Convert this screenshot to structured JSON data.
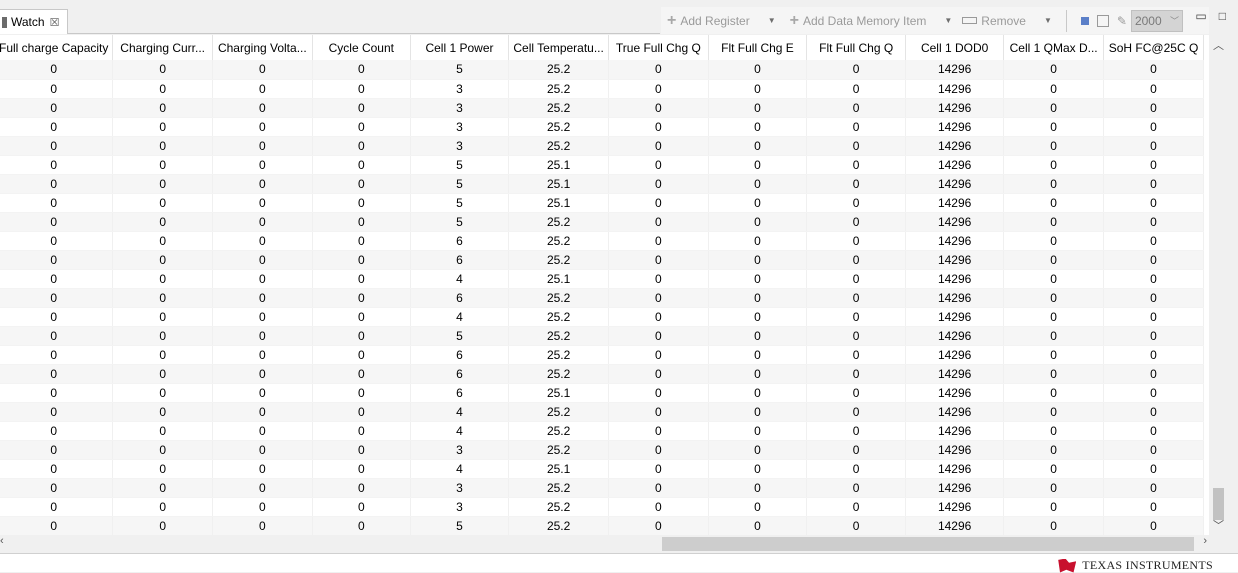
{
  "view": {
    "tab_title": "Watch",
    "close_glyph": "☒"
  },
  "toolbar": {
    "add_register": "Add Register",
    "add_data_memory_item": "Add Data Memory Item",
    "remove": "Remove",
    "interval": "2000"
  },
  "columns": [
    "Full charge Capacity",
    "Charging Curr...",
    "Charging Volta...",
    "Cycle Count",
    "Cell 1 Power",
    "Cell Temperatu...",
    "True Full Chg Q",
    "Flt Full Chg E",
    "Flt Full Chg Q",
    "Cell 1 DOD0",
    "Cell 1 QMax D...",
    "SoH FC@25C Q"
  ],
  "rows": [
    [
      "0",
      "0",
      "0",
      "0",
      "5",
      "25.2",
      "0",
      "0",
      "0",
      "14296",
      "0",
      "0"
    ],
    [
      "0",
      "0",
      "0",
      "0",
      "3",
      "25.2",
      "0",
      "0",
      "0",
      "14296",
      "0",
      "0"
    ],
    [
      "0",
      "0",
      "0",
      "0",
      "3",
      "25.2",
      "0",
      "0",
      "0",
      "14296",
      "0",
      "0"
    ],
    [
      "0",
      "0",
      "0",
      "0",
      "3",
      "25.2",
      "0",
      "0",
      "0",
      "14296",
      "0",
      "0"
    ],
    [
      "0",
      "0",
      "0",
      "0",
      "3",
      "25.2",
      "0",
      "0",
      "0",
      "14296",
      "0",
      "0"
    ],
    [
      "0",
      "0",
      "0",
      "0",
      "5",
      "25.1",
      "0",
      "0",
      "0",
      "14296",
      "0",
      "0"
    ],
    [
      "0",
      "0",
      "0",
      "0",
      "5",
      "25.1",
      "0",
      "0",
      "0",
      "14296",
      "0",
      "0"
    ],
    [
      "0",
      "0",
      "0",
      "0",
      "5",
      "25.1",
      "0",
      "0",
      "0",
      "14296",
      "0",
      "0"
    ],
    [
      "0",
      "0",
      "0",
      "0",
      "5",
      "25.2",
      "0",
      "0",
      "0",
      "14296",
      "0",
      "0"
    ],
    [
      "0",
      "0",
      "0",
      "0",
      "6",
      "25.2",
      "0",
      "0",
      "0",
      "14296",
      "0",
      "0"
    ],
    [
      "0",
      "0",
      "0",
      "0",
      "6",
      "25.2",
      "0",
      "0",
      "0",
      "14296",
      "0",
      "0"
    ],
    [
      "0",
      "0",
      "0",
      "0",
      "4",
      "25.1",
      "0",
      "0",
      "0",
      "14296",
      "0",
      "0"
    ],
    [
      "0",
      "0",
      "0",
      "0",
      "6",
      "25.2",
      "0",
      "0",
      "0",
      "14296",
      "0",
      "0"
    ],
    [
      "0",
      "0",
      "0",
      "0",
      "4",
      "25.2",
      "0",
      "0",
      "0",
      "14296",
      "0",
      "0"
    ],
    [
      "0",
      "0",
      "0",
      "0",
      "5",
      "25.2",
      "0",
      "0",
      "0",
      "14296",
      "0",
      "0"
    ],
    [
      "0",
      "0",
      "0",
      "0",
      "6",
      "25.2",
      "0",
      "0",
      "0",
      "14296",
      "0",
      "0"
    ],
    [
      "0",
      "0",
      "0",
      "0",
      "6",
      "25.2",
      "0",
      "0",
      "0",
      "14296",
      "0",
      "0"
    ],
    [
      "0",
      "0",
      "0",
      "0",
      "6",
      "25.1",
      "0",
      "0",
      "0",
      "14296",
      "0",
      "0"
    ],
    [
      "0",
      "0",
      "0",
      "0",
      "4",
      "25.2",
      "0",
      "0",
      "0",
      "14296",
      "0",
      "0"
    ],
    [
      "0",
      "0",
      "0",
      "0",
      "4",
      "25.2",
      "0",
      "0",
      "0",
      "14296",
      "0",
      "0"
    ],
    [
      "0",
      "0",
      "0",
      "0",
      "3",
      "25.2",
      "0",
      "0",
      "0",
      "14296",
      "0",
      "0"
    ],
    [
      "0",
      "0",
      "0",
      "0",
      "4",
      "25.1",
      "0",
      "0",
      "0",
      "14296",
      "0",
      "0"
    ],
    [
      "0",
      "0",
      "0",
      "0",
      "3",
      "25.2",
      "0",
      "0",
      "0",
      "14296",
      "0",
      "0"
    ],
    [
      "0",
      "0",
      "0",
      "0",
      "3",
      "25.2",
      "0",
      "0",
      "0",
      "14296",
      "0",
      "0"
    ],
    [
      "0",
      "0",
      "0",
      "0",
      "5",
      "25.2",
      "0",
      "0",
      "0",
      "14296",
      "0",
      "0"
    ]
  ],
  "footer": {
    "brand": "TEXAS INSTRUMENTS"
  }
}
